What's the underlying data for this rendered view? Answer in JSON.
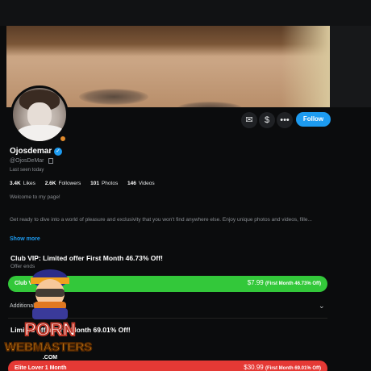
{
  "profile": {
    "name": "Ojosdemar",
    "handle": "@OjosDeMar",
    "last_seen": "Last seen today",
    "follow_label": "Follow"
  },
  "stats": {
    "likes_value": "3.4K",
    "likes_label": "Likes",
    "followers_value": "2.6K",
    "followers_label": "Followers",
    "photos_value": "101",
    "photos_label": "Photos",
    "videos_value": "146",
    "videos_label": "Videos"
  },
  "bio": {
    "welcome": "Welcome to my page!",
    "text": "Get ready to dive into a world of pleasure and exclusivity that you won't find anywhere else. Enjoy unique photos and videos, fille...",
    "show_more": "Show more"
  },
  "offer1": {
    "title": "Club VIP: Limited offer First Month 46.73% Off!",
    "subtitle": "Offer ends",
    "plan_name": "Club V",
    "price": "$7.99",
    "price_note": "(First Month 46.73% Off)",
    "color": "#33c83a"
  },
  "additional": {
    "label": "Additional Plans"
  },
  "offer2": {
    "title": "Limited offer First Month 69.01% Off!",
    "plan_name": "Elite Lover 1 Month",
    "price": "$30.99",
    "price_note": "(First Month 69.01% Off)",
    "color": "#e53935"
  },
  "watermark": {
    "line1": "PORN",
    "line2": "WEBMASTERS",
    "line3": ".COM"
  },
  "icons": {
    "message": "mail-icon",
    "tip": "dollar-icon",
    "more": "more-icon"
  },
  "colors": {
    "accent": "#1d9bf0",
    "online": "#e08a2c"
  }
}
